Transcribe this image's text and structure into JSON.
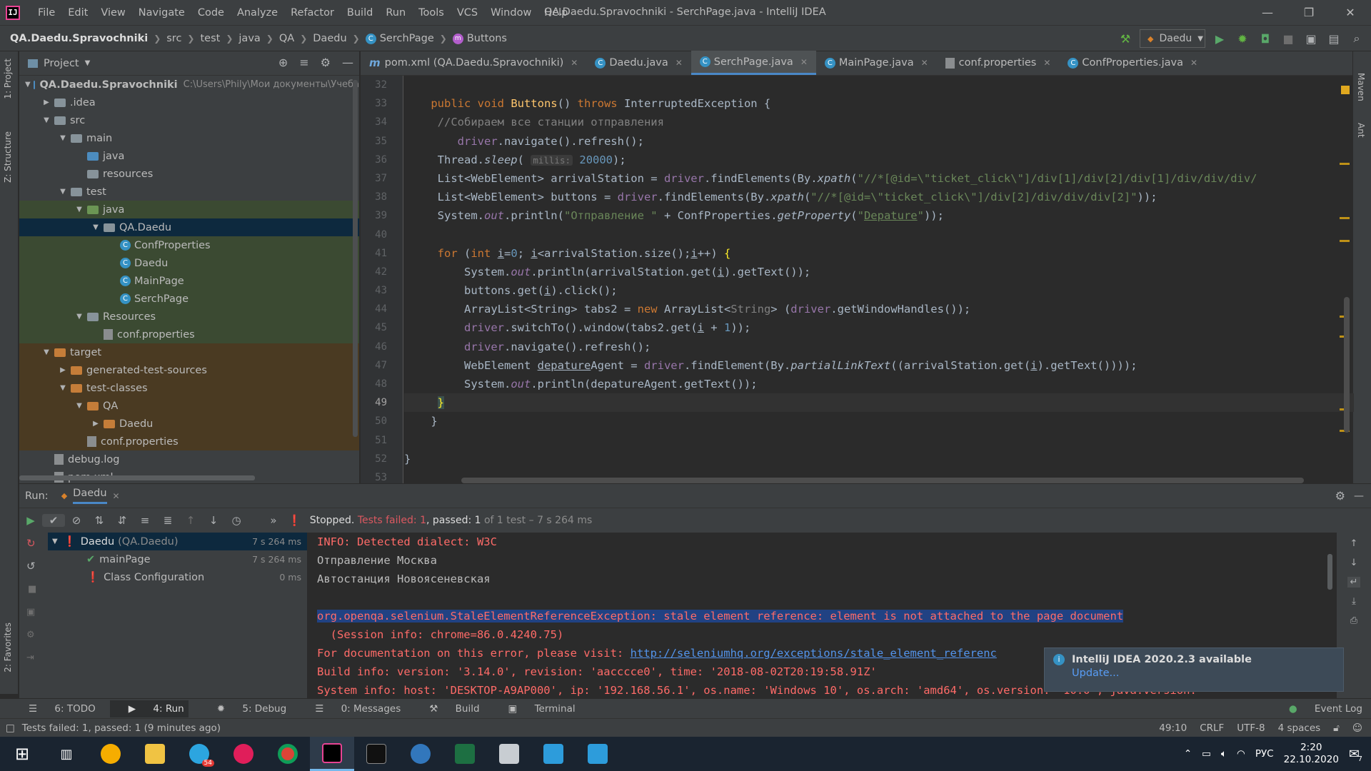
{
  "menubar": {
    "items": [
      "File",
      "Edit",
      "View",
      "Navigate",
      "Code",
      "Analyze",
      "Refactor",
      "Build",
      "Run",
      "Tools",
      "VCS",
      "Window",
      "Help"
    ],
    "title": "QA.Daedu.Spravochniki - SerchPage.java - IntelliJ IDEA"
  },
  "breadcrumbs": [
    "QA.Daedu.Spravochniki",
    "src",
    "test",
    "java",
    "QA",
    "Daedu",
    "SerchPage",
    "Buttons"
  ],
  "run_config": "Daedu",
  "project_panel": {
    "title": "Project",
    "tree": [
      {
        "label": "QA.Daedu.Spravochniki",
        "path": "C:\\Users\\Phily\\Мои документы\\Учеба",
        "depth": 0,
        "open": true,
        "kind": "folder-blue"
      },
      {
        "label": ".idea",
        "depth": 1,
        "open": false,
        "kind": "folder"
      },
      {
        "label": "src",
        "depth": 1,
        "open": true,
        "kind": "folder"
      },
      {
        "label": "main",
        "depth": 2,
        "open": true,
        "kind": "folder"
      },
      {
        "label": "java",
        "depth": 3,
        "kind": "folder-blue"
      },
      {
        "label": "resources",
        "depth": 3,
        "kind": "folder"
      },
      {
        "label": "test",
        "depth": 2,
        "open": true,
        "kind": "folder"
      },
      {
        "label": "java",
        "depth": 3,
        "open": true,
        "kind": "folder-green"
      },
      {
        "label": "QA.Daedu",
        "depth": 4,
        "open": true,
        "kind": "folder"
      },
      {
        "label": "ConfProperties",
        "depth": 5,
        "kind": "class"
      },
      {
        "label": "Daedu",
        "depth": 5,
        "kind": "class"
      },
      {
        "label": "MainPage",
        "depth": 5,
        "kind": "class"
      },
      {
        "label": "SerchPage",
        "depth": 5,
        "kind": "class"
      },
      {
        "label": "Resources",
        "depth": 3,
        "open": true,
        "kind": "folder"
      },
      {
        "label": "conf.properties",
        "depth": 4,
        "kind": "file"
      },
      {
        "label": "target",
        "depth": 1,
        "open": true,
        "kind": "folder-orange"
      },
      {
        "label": "generated-test-sources",
        "depth": 2,
        "open": false,
        "kind": "folder-orange"
      },
      {
        "label": "test-classes",
        "depth": 2,
        "open": true,
        "kind": "folder-orange"
      },
      {
        "label": "QA",
        "depth": 3,
        "open": true,
        "kind": "folder-orange"
      },
      {
        "label": "Daedu",
        "depth": 4,
        "open": false,
        "kind": "folder-orange"
      },
      {
        "label": "conf.properties",
        "depth": 3,
        "kind": "file"
      },
      {
        "label": "debug.log",
        "depth": 1,
        "kind": "file"
      },
      {
        "label": "pom.xml",
        "depth": 1,
        "kind": "file"
      }
    ]
  },
  "editor_tabs": [
    {
      "label": "pom.xml (QA.Daedu.Spravochniki)",
      "icon": "m"
    },
    {
      "label": "Daedu.java",
      "icon": "c"
    },
    {
      "label": "SerchPage.java",
      "icon": "c",
      "active": true
    },
    {
      "label": "MainPage.java",
      "icon": "c"
    },
    {
      "label": "conf.properties",
      "icon": "f"
    },
    {
      "label": "ConfProperties.java",
      "icon": "c"
    }
  ],
  "line_numbers": [
    "32",
    "33",
    "34",
    "35",
    "36",
    "37",
    "38",
    "39",
    "40",
    "41",
    "42",
    "43",
    "44",
    "45",
    "46",
    "47",
    "48",
    "49",
    "50",
    "51",
    "52",
    "53"
  ],
  "run_panel": {
    "label": "Run:",
    "tab": "Daedu",
    "status_stopped": "Stopped.",
    "status_failed": "Tests failed: 1",
    "status_passed": ", passed: 1",
    "status_rest": " of 1 test – 7 s 264 ms",
    "tests": [
      {
        "label": "Daedu",
        "sub": "(QA.Daedu)",
        "time": "7 s 264 ms",
        "state": "fail"
      },
      {
        "label": "mainPage",
        "time": "7 s 264 ms",
        "state": "pass"
      },
      {
        "label": "Class Configuration",
        "time": "0 ms",
        "state": "fail"
      }
    ],
    "console": [
      "INFO: Detected dialect: W3C",
      "Отправление Москва",
      "Автостанция Новоясеневская",
      "",
      "org.openqa.selenium.StaleElementReferenceException: stale element reference: element is not attached to the page document",
      "  (Session info: chrome=86.0.4240.75)",
      "For documentation on this error, please visit: ",
      "Build info: version: '3.14.0', revision: 'aacccce0', time: '2018-08-02T20:19:58.91Z'",
      "System info: host: 'DESKTOP-A9AP000', ip: '192.168.56.1', os.name: 'Windows 10', os.arch: 'amd64', os.version: '10.0', java.version:"
    ],
    "doc_link": "http://seleniumhq.org/exceptions/stale_element_referenc"
  },
  "notification": {
    "title": "IntelliJ IDEA 2020.2.3 available",
    "link": "Update..."
  },
  "bottom_tabs": [
    "6: TODO",
    "4: Run",
    "5: Debug",
    "0: Messages",
    "Build",
    "Terminal"
  ],
  "event_log": "Event Log",
  "statusbar": {
    "message": "Tests failed: 1, passed: 1 (9 minutes ago)",
    "position": "49:10",
    "line_sep": "CRLF",
    "encoding": "UTF-8",
    "indent": "4 spaces"
  },
  "taskbar": {
    "lang": "РУС",
    "time": "2:20",
    "date": "22.10.2020",
    "telegram_badge": "54",
    "notif_count": "7"
  },
  "side_tabs": {
    "project": "1: Project",
    "structure": "Z: Structure",
    "favorites": "2: Favorites",
    "maven": "Maven",
    "ant": "Ant"
  }
}
